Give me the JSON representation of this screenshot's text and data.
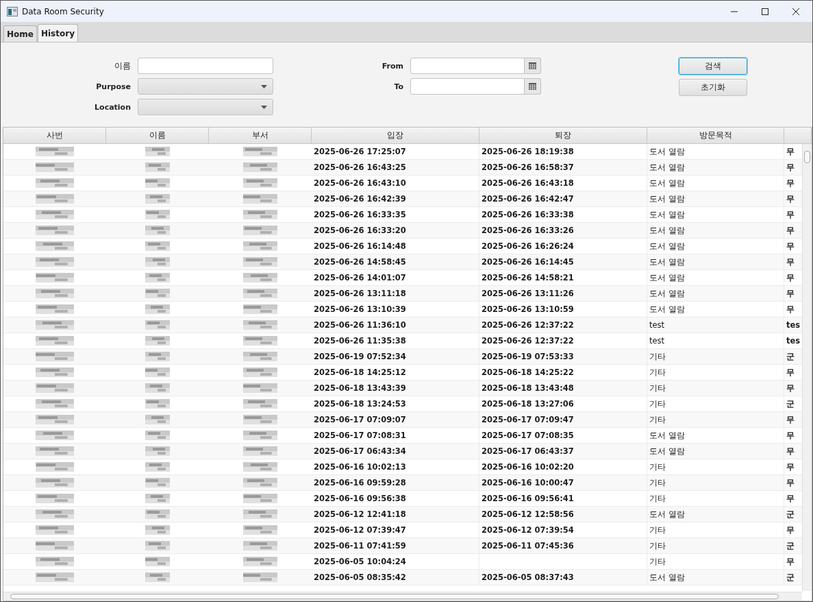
{
  "window": {
    "title": "Data Room Security"
  },
  "tabs": [
    {
      "label": "Home",
      "selected": false
    },
    {
      "label": "History",
      "selected": true
    }
  ],
  "filters": {
    "name_label": "이름",
    "purpose_label": "Purpose",
    "location_label": "Location",
    "from_label": "From",
    "to_label": "To"
  },
  "buttons": [
    {
      "label": "검색",
      "focused": true
    },
    {
      "label": "초기화",
      "focused": false
    }
  ],
  "table": {
    "columns": [
      "사번",
      "이름",
      "부서",
      "입장",
      "퇴장",
      "방문목적"
    ],
    "rows": [
      {
        "entry": "2025-06-26 17:25:07",
        "exit": "2025-06-26 18:19:38",
        "purpose": "도서 열람",
        "column_7": "무"
      },
      {
        "entry": "2025-06-26 16:43:25",
        "exit": "2025-06-26 16:58:37",
        "purpose": "도서 열람",
        "column_7": "무"
      },
      {
        "entry": "2025-06-26 16:43:10",
        "exit": "2025-06-26 16:43:18",
        "purpose": "도서 열람",
        "column_7": "무"
      },
      {
        "entry": "2025-06-26 16:42:39",
        "exit": "2025-06-26 16:42:47",
        "purpose": "도서 열람",
        "column_7": "무"
      },
      {
        "entry": "2025-06-26 16:33:35",
        "exit": "2025-06-26 16:33:38",
        "purpose": "도서 열람",
        "column_7": "무"
      },
      {
        "entry": "2025-06-26 16:33:20",
        "exit": "2025-06-26 16:33:26",
        "purpose": "도서 열람",
        "column_7": "무"
      },
      {
        "entry": "2025-06-26 16:14:48",
        "exit": "2025-06-26 16:26:24",
        "purpose": "도서 열람",
        "column_7": "무"
      },
      {
        "entry": "2025-06-26 14:58:45",
        "exit": "2025-06-26 16:14:45",
        "purpose": "도서 열람",
        "column_7": "무"
      },
      {
        "entry": "2025-06-26 14:01:07",
        "exit": "2025-06-26 14:58:21",
        "purpose": "도서 열람",
        "column_7": "무"
      },
      {
        "entry": "2025-06-26 13:11:18",
        "exit": "2025-06-26 13:11:26",
        "purpose": "도서 열람",
        "column_7": "무"
      },
      {
        "entry": "2025-06-26 13:10:39",
        "exit": "2025-06-26 13:10:59",
        "purpose": "도서 열람",
        "column_7": "무"
      },
      {
        "entry": "2025-06-26 11:36:10",
        "exit": "2025-06-26 12:37:22",
        "purpose": "test",
        "column_7": "tes"
      },
      {
        "entry": "2025-06-26 11:35:38",
        "exit": "2025-06-26 12:37:22",
        "purpose": "test",
        "column_7": "tes"
      },
      {
        "entry": "2025-06-19 07:52:34",
        "exit": "2025-06-19 07:53:33",
        "purpose": "기타",
        "column_7": "군"
      },
      {
        "entry": "2025-06-18 14:25:12",
        "exit": "2025-06-18 14:25:22",
        "purpose": "기타",
        "column_7": "무"
      },
      {
        "entry": "2025-06-18 13:43:39",
        "exit": "2025-06-18 13:43:48",
        "purpose": "기타",
        "column_7": "무"
      },
      {
        "entry": "2025-06-18 13:24:53",
        "exit": "2025-06-18 13:27:06",
        "purpose": "기타",
        "column_7": "군"
      },
      {
        "entry": "2025-06-17 07:09:07",
        "exit": "2025-06-17 07:09:47",
        "purpose": "기타",
        "column_7": "무"
      },
      {
        "entry": "2025-06-17 07:08:31",
        "exit": "2025-06-17 07:08:35",
        "purpose": "도서 열람",
        "column_7": "무"
      },
      {
        "entry": "2025-06-17 06:43:34",
        "exit": "2025-06-17 06:43:37",
        "purpose": "도서 열람",
        "column_7": "무"
      },
      {
        "entry": "2025-06-16 10:02:13",
        "exit": "2025-06-16 10:02:20",
        "purpose": "기타",
        "column_7": "무"
      },
      {
        "entry": "2025-06-16 09:59:28",
        "exit": "2025-06-16 10:00:47",
        "purpose": "기타",
        "column_7": "무"
      },
      {
        "entry": "2025-06-16 09:56:38",
        "exit": "2025-06-16 09:56:41",
        "purpose": "기타",
        "column_7": "무"
      },
      {
        "entry": "2025-06-12 12:41:18",
        "exit": "2025-06-12 12:58:56",
        "purpose": "도서 열람",
        "column_7": "군"
      },
      {
        "entry": "2025-06-12 07:39:47",
        "exit": "2025-06-12 07:39:54",
        "purpose": "기타",
        "column_7": "무"
      },
      {
        "entry": "2025-06-11 07:41:59",
        "exit": "2025-06-11 07:45:36",
        "purpose": "기타",
        "column_7": "군"
      },
      {
        "entry": "2025-06-05 10:04:24",
        "purpose": "기타",
        "column_7": "무"
      },
      {
        "entry": "2025-06-05 08:35:42",
        "exit": "2025-06-05 08:37:43",
        "purpose": "도서 열람",
        "column_7": "군"
      }
    ]
  }
}
